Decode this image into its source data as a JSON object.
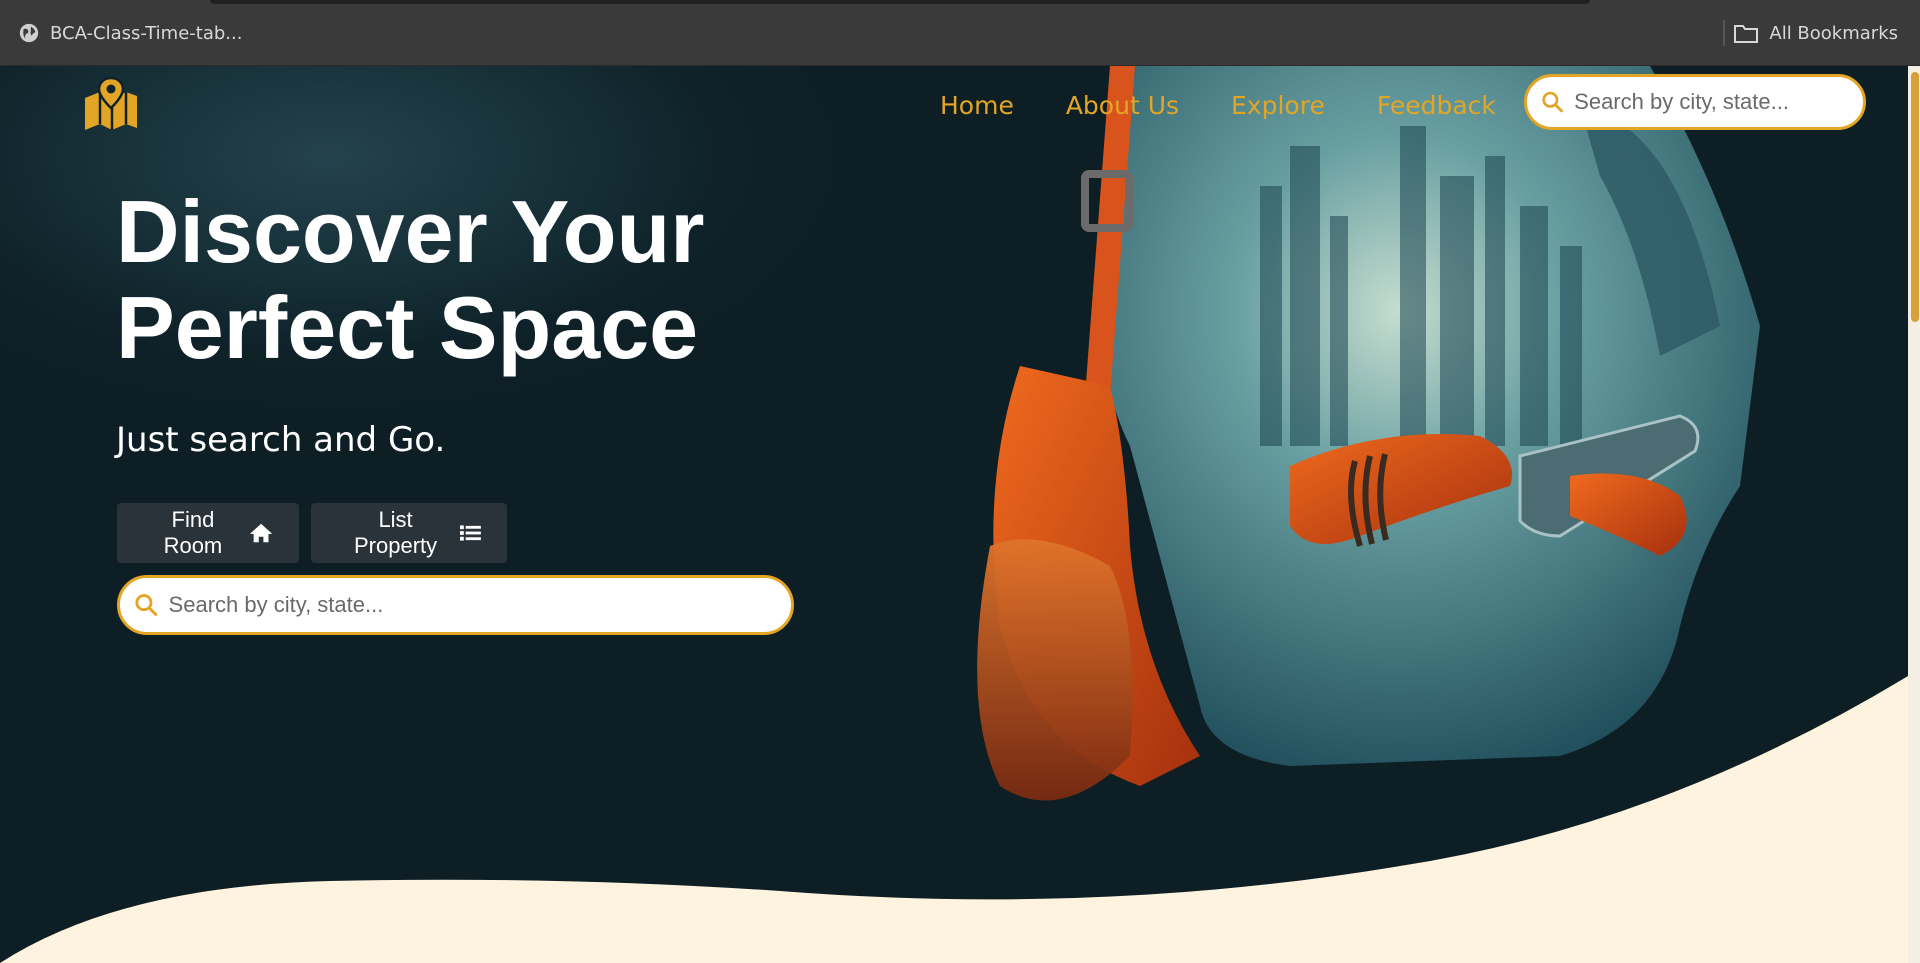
{
  "browser": {
    "bookmark_tab": "BCA-Class-Time-tab...",
    "bookmark_tab_icon": "globe-icon",
    "all_bookmarks": "All Bookmarks",
    "all_bookmarks_icon": "folder-icon"
  },
  "nav": {
    "logo_icon": "map-pin-icon",
    "links": [
      "Home",
      "About Us",
      "Explore",
      "Feedback"
    ],
    "search": {
      "placeholder": "Search by city, state...",
      "icon": "search-icon"
    }
  },
  "hero": {
    "headline_line1": "Discover Your",
    "headline_line2": "Perfect Space",
    "subline": "Just search and Go.",
    "find_room_label": "Find Room",
    "find_room_icon": "home-icon",
    "list_property_label": "List Property",
    "list_property_icon": "list-icon",
    "search": {
      "placeholder": "Search by city, state...",
      "icon": "search-icon"
    }
  },
  "colors": {
    "accent": "#e3a526",
    "hero_bg": "#0f2229",
    "cream": "#fdf3de",
    "button_bg": "#2a3339"
  }
}
